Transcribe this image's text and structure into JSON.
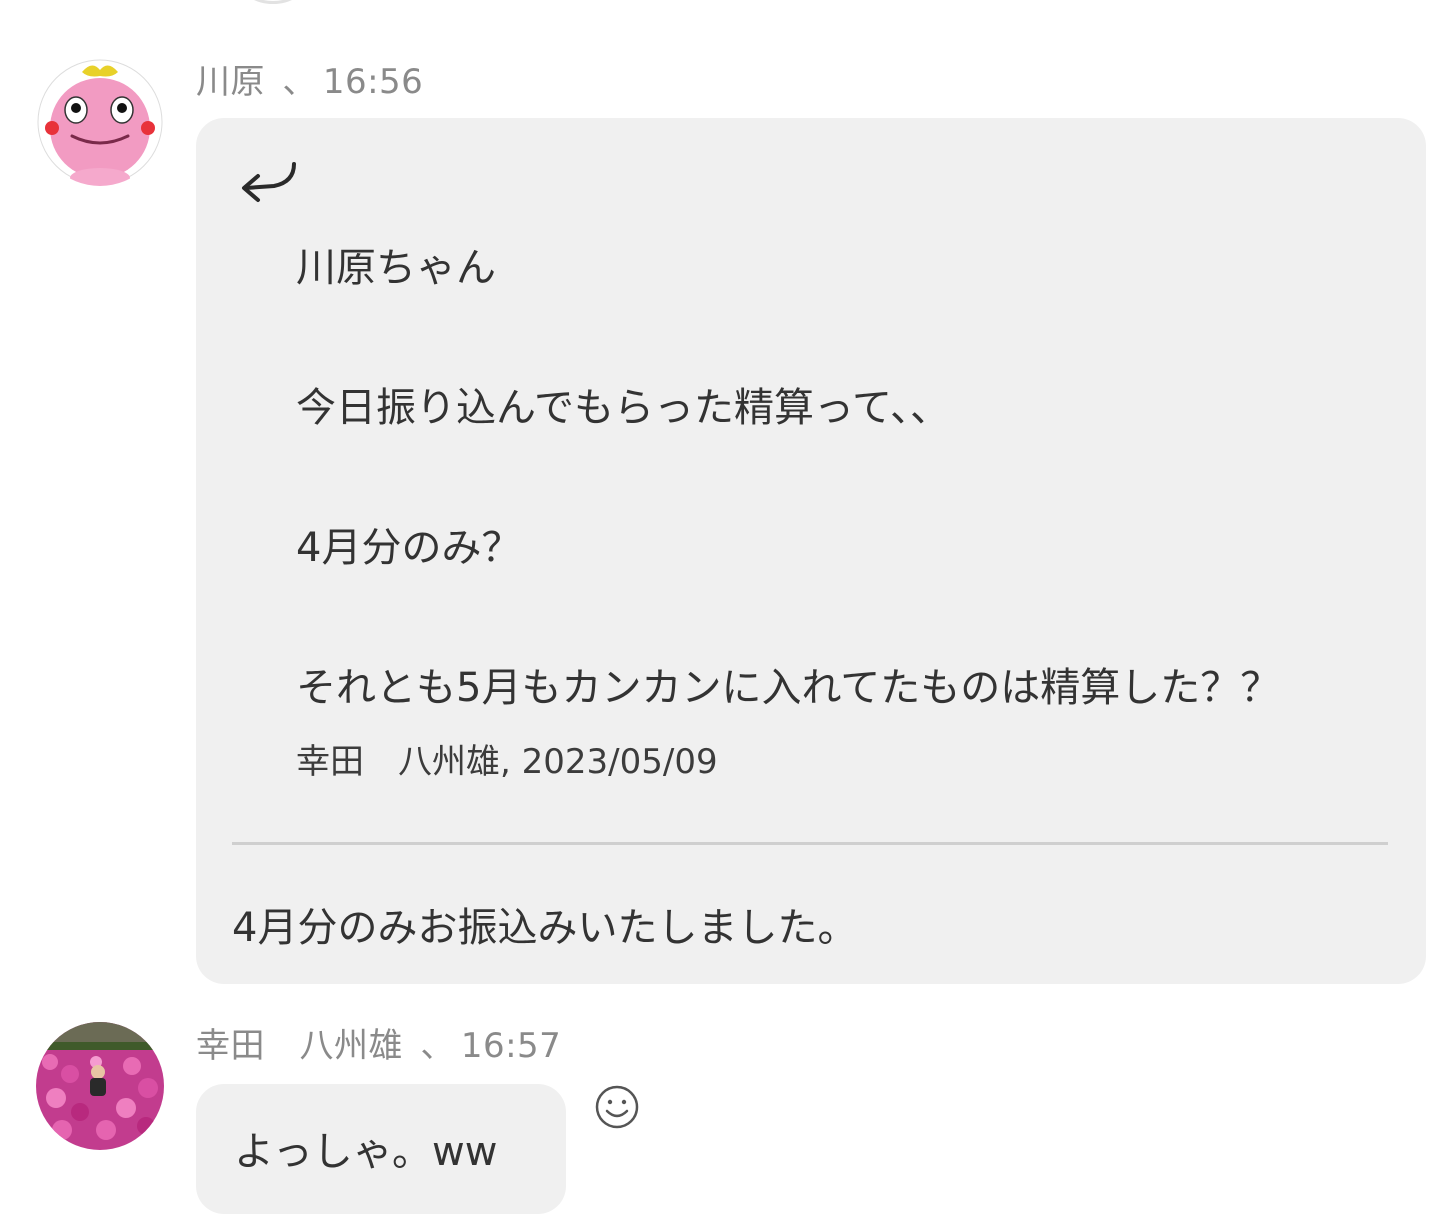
{
  "messages": [
    {
      "author": "川原",
      "separator": "、",
      "time": "16:56",
      "avatar_icon": "pink-mascot-avatar",
      "quote": {
        "icon": "reply-arrow-icon",
        "lines": [
          "川原ちゃん",
          "今日振り込んでもらった精算って、、",
          "4月分のみ？",
          "それとも5月もカンカンに入れてたものは精算した？？"
        ],
        "source": "幸田　八州雄, 2023/05/09"
      },
      "text": "4月分のみお振込みいたしました。"
    },
    {
      "author": "幸田　八州雄",
      "separator": "、",
      "time": "16:57",
      "avatar_icon": "flower-field-avatar",
      "text": "よっしゃ。ww",
      "reaction_icon": "smiley-reaction-icon"
    }
  ],
  "colors": {
    "bubble": "#f0f0f0",
    "meta_text": "#8a8a8a",
    "body_text": "#333333",
    "divider": "#cfcfcf"
  }
}
